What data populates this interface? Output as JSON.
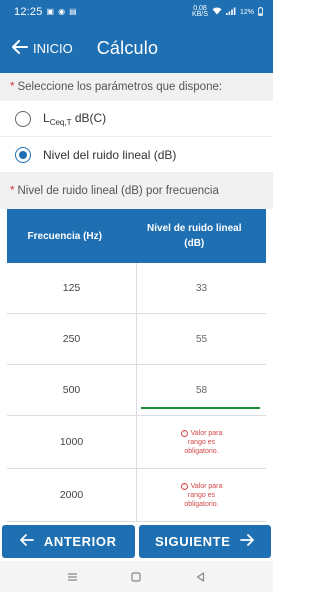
{
  "status": {
    "time": "12:25",
    "net_speed_value": "0,08",
    "net_speed_unit": "KB/S",
    "battery": "12%"
  },
  "app_bar": {
    "back_label": "INICIO",
    "title": "Cálculo"
  },
  "params": {
    "label": "Seleccione los parámetros que dispone:",
    "options": [
      {
        "main": "L",
        "sub": "Ceq,T",
        "suffix": " dB(C)",
        "selected": false
      },
      {
        "main": "Nivel del ruido lineal (dB)",
        "sub": "",
        "suffix": "",
        "selected": true
      }
    ]
  },
  "freq_section": {
    "label": "Nivel de ruido lineal (dB) por frecuencia"
  },
  "table": {
    "headers": [
      "Frecuencia (Hz)",
      "Nivel de ruido lineal (dB)"
    ],
    "rows": [
      {
        "freq": "125",
        "value": "33"
      },
      {
        "freq": "250",
        "value": "55"
      },
      {
        "freq": "500",
        "value": "58"
      },
      {
        "freq": "1000",
        "value": ""
      },
      {
        "freq": "2000",
        "value": ""
      }
    ],
    "error_line1": "Valor para",
    "error_line2": "rango es",
    "error_line3": "obligatorio."
  },
  "buttons": {
    "previous": "ANTERIOR",
    "next": "SIGUIENTE"
  },
  "colors": {
    "primary": "#1f6fb3",
    "error": "#d24848",
    "focus_underline": "#1a8a3a"
  }
}
